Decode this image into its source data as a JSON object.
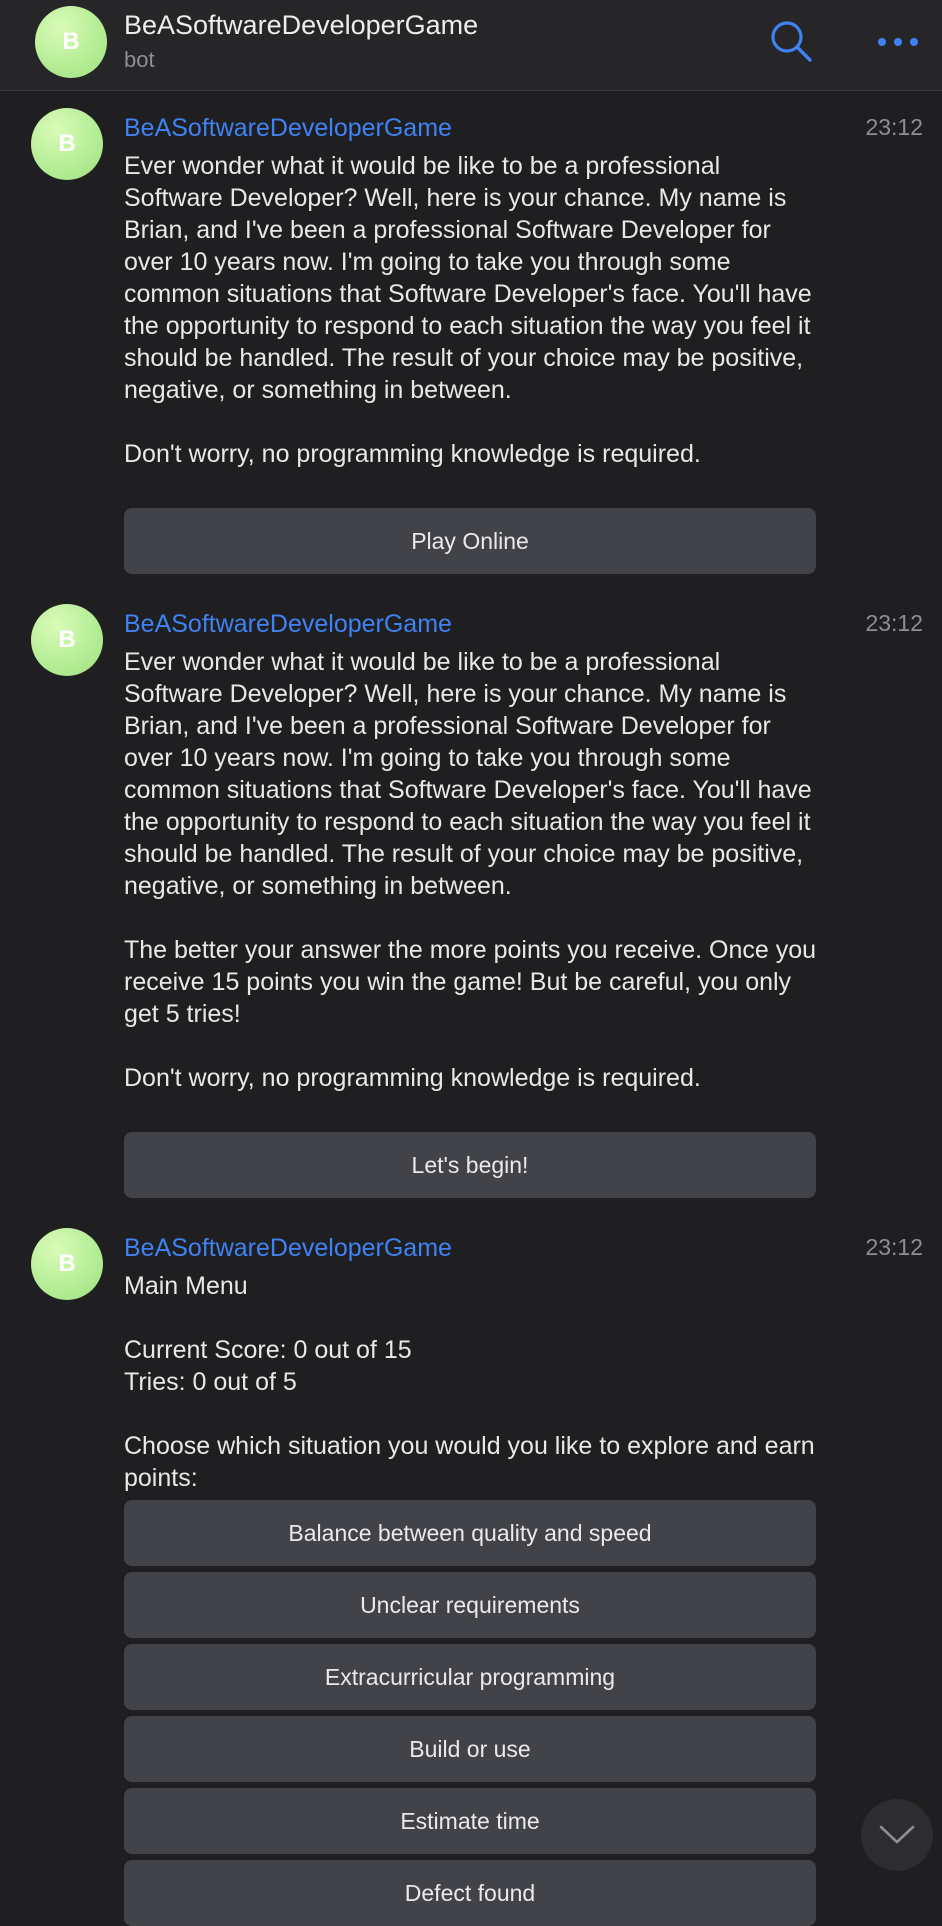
{
  "header": {
    "avatar_letter": "B",
    "title": "BeASoftwareDeveloperGame",
    "subtitle": "bot",
    "search_icon": "search-icon",
    "more_icon": "more-icon",
    "accent_color": "#3f82f2"
  },
  "messages": [
    {
      "avatar_letter": "B",
      "sender": "BeASoftwareDeveloperGame",
      "time": "23:12",
      "text": "Ever wonder what it would be like to be a professional Software Developer? Well, here is your chance. My name is Brian, and I've been a professional Software Developer for over 10 years now. I'm going to take you through some common situations that Software Developer's face. You'll have the opportunity to respond to each situation the way you feel it should be handled. The result of your choice may be positive, negative, or something in between.\n\nDon't worry, no programming knowledge is required.",
      "buttons": [
        "Play Online"
      ]
    },
    {
      "avatar_letter": "B",
      "sender": "BeASoftwareDeveloperGame",
      "time": "23:12",
      "text": "Ever wonder what it would be like to be a professional Software Developer? Well, here is your chance. My name is Brian, and I've been a professional Software Developer for over 10 years now. I'm going to take you through some common situations that Software Developer's face. You'll have the opportunity to respond to each situation the way you feel it should be handled. The result of your choice may be positive, negative, or something in between.\n\nThe better your answer the more points you receive. Once you receive 15 points you win the game! But be careful, you only get 5 tries!\n\nDon't worry, no programming knowledge is required.",
      "buttons": [
        "Let's begin!"
      ]
    },
    {
      "avatar_letter": "B",
      "sender": "BeASoftwareDeveloperGame",
      "time": "23:12",
      "text": "Main Menu\n\nCurrent Score: 0 out of 15\nTries: 0 out of 5\n\nChoose which situation you would you like to explore and earn points:",
      "buttons": [
        "Balance between quality and speed",
        "Unclear requirements",
        "Extracurricular programming",
        "Build or use",
        "Estimate time",
        "Defect found"
      ]
    }
  ],
  "scroll_down_icon": "chevron-down-icon"
}
